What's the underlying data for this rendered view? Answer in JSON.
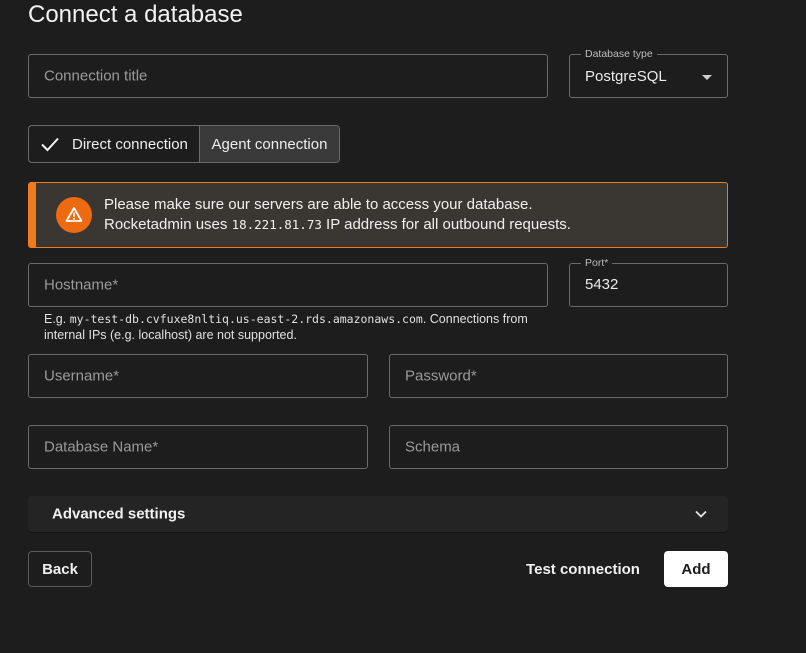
{
  "page": {
    "title": "Connect a database"
  },
  "form": {
    "connection_title": {
      "placeholder": "Connection title",
      "value": ""
    },
    "database_type": {
      "label": "Database type",
      "value": "PostgreSQL"
    },
    "connection_mode": {
      "options": [
        "Direct connection",
        "Agent connection"
      ],
      "selected": "Direct connection"
    },
    "alert": {
      "line1": "Please make sure our servers are able to access your database.",
      "line2_prefix": "Rocketadmin uses ",
      "ip": "18.221.81.73",
      "line2_suffix": " IP address for all outbound requests."
    },
    "hostname": {
      "placeholder": "Hostname*",
      "value": ""
    },
    "port": {
      "label": "Port*",
      "value": "5432"
    },
    "hostname_hint": {
      "prefix": " E.g. ",
      "example": "my-test-db.cvfuxe8nltiq.us-east-2.rds.amazonaws.com",
      "suffix": ". Connections from internal IPs (e.g. localhost) are not supported."
    },
    "username": {
      "placeholder": "Username*",
      "value": ""
    },
    "password": {
      "placeholder": "Password*",
      "value": ""
    },
    "database_name": {
      "placeholder": "Database Name*",
      "value": ""
    },
    "schema": {
      "placeholder": "Schema",
      "value": ""
    }
  },
  "advanced": {
    "label": "Advanced settings",
    "expanded": false
  },
  "actions": {
    "back": "Back",
    "test": "Test connection",
    "add": "Add"
  },
  "colors": {
    "accent_warning": "#ef7b1b",
    "background": "#1d1d1d",
    "primary_button": "#ffffff"
  },
  "icons": {
    "check": "check-icon",
    "warning": "warning-icon",
    "dropdown": "chevron-down-icon"
  }
}
